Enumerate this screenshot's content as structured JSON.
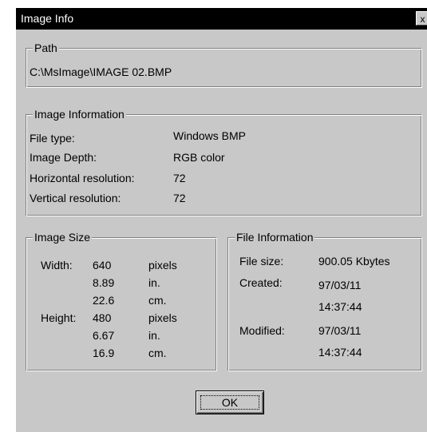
{
  "window": {
    "title": "Image Info",
    "close_glyph": "x"
  },
  "path": {
    "legend": "Path",
    "value": "C:\\MsImage\\IMAGE 02.BMP"
  },
  "image_information": {
    "legend": "Image Information",
    "rows": [
      {
        "label": "File type:",
        "value": "Windows BMP"
      },
      {
        "label": "Image Depth:",
        "value": "RGB color"
      },
      {
        "label": "Horizontal resolution:",
        "value": "72"
      },
      {
        "label": "Vertical resolution:",
        "value": "72"
      }
    ]
  },
  "image_size": {
    "legend": "Image Size",
    "width_label": "Width:",
    "height_label": "Height:",
    "width": [
      {
        "value": "640",
        "unit": "pixels"
      },
      {
        "value": "8.89",
        "unit": "in."
      },
      {
        "value": "22.6",
        "unit": "cm."
      }
    ],
    "height": [
      {
        "value": "480",
        "unit": "pixels"
      },
      {
        "value": "6.67",
        "unit": "in."
      },
      {
        "value": "16.9",
        "unit": "cm."
      }
    ]
  },
  "file_information": {
    "legend": "File Information",
    "size_label": "File size:",
    "size_value": "900.05 Kbytes",
    "created_label": "Created:",
    "created_date": "97/03/11",
    "created_time": "14:37:44",
    "modified_label": "Modified:",
    "modified_date": "97/03/11",
    "modified_time": "14:37:44"
  },
  "buttons": {
    "ok_label": "OK"
  }
}
